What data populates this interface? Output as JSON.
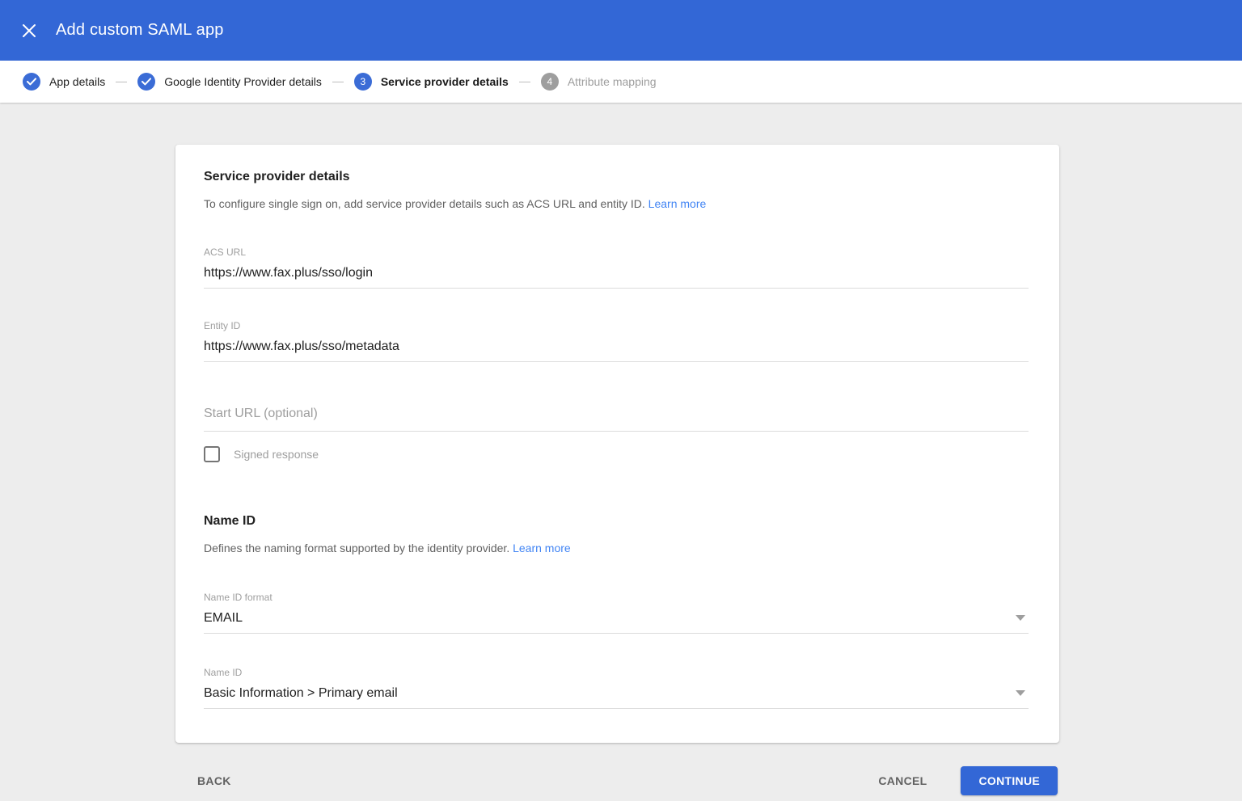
{
  "header": {
    "title": "Add custom SAML app"
  },
  "stepper": {
    "steps": [
      {
        "label": "App details",
        "state": "complete"
      },
      {
        "label": "Google Identity Provider details",
        "state": "complete"
      },
      {
        "number": "3",
        "label": "Service provider details",
        "state": "active"
      },
      {
        "number": "4",
        "label": "Attribute mapping",
        "state": "upcoming"
      }
    ]
  },
  "card": {
    "service_provider": {
      "title": "Service provider details",
      "description": "To configure single sign on, add service provider details such as ACS URL and entity ID.",
      "learn_more": "Learn more"
    },
    "fields": {
      "acs_url": {
        "label": "ACS URL",
        "value": "https://www.fax.plus/sso/login"
      },
      "entity_id": {
        "label": "Entity ID",
        "value": "https://www.fax.plus/sso/metadata"
      },
      "start_url": {
        "placeholder": "Start URL (optional)"
      },
      "signed_response": {
        "label": "Signed response",
        "checked": false
      }
    },
    "name_id": {
      "title": "Name ID",
      "description": "Defines the naming format supported by the identity provider.",
      "learn_more": "Learn more"
    },
    "dropdowns": {
      "name_id_format": {
        "label": "Name ID format",
        "value": "EMAIL"
      },
      "name_id": {
        "label": "Name ID",
        "value": "Basic Information > Primary email"
      }
    }
  },
  "footer": {
    "back": "BACK",
    "cancel": "CANCEL",
    "continue": "CONTINUE"
  },
  "colors": {
    "primary_blue": "#3367d6",
    "link_blue": "#4285f4",
    "inactive_gray": "#9e9e9e",
    "background": "#ededed"
  }
}
